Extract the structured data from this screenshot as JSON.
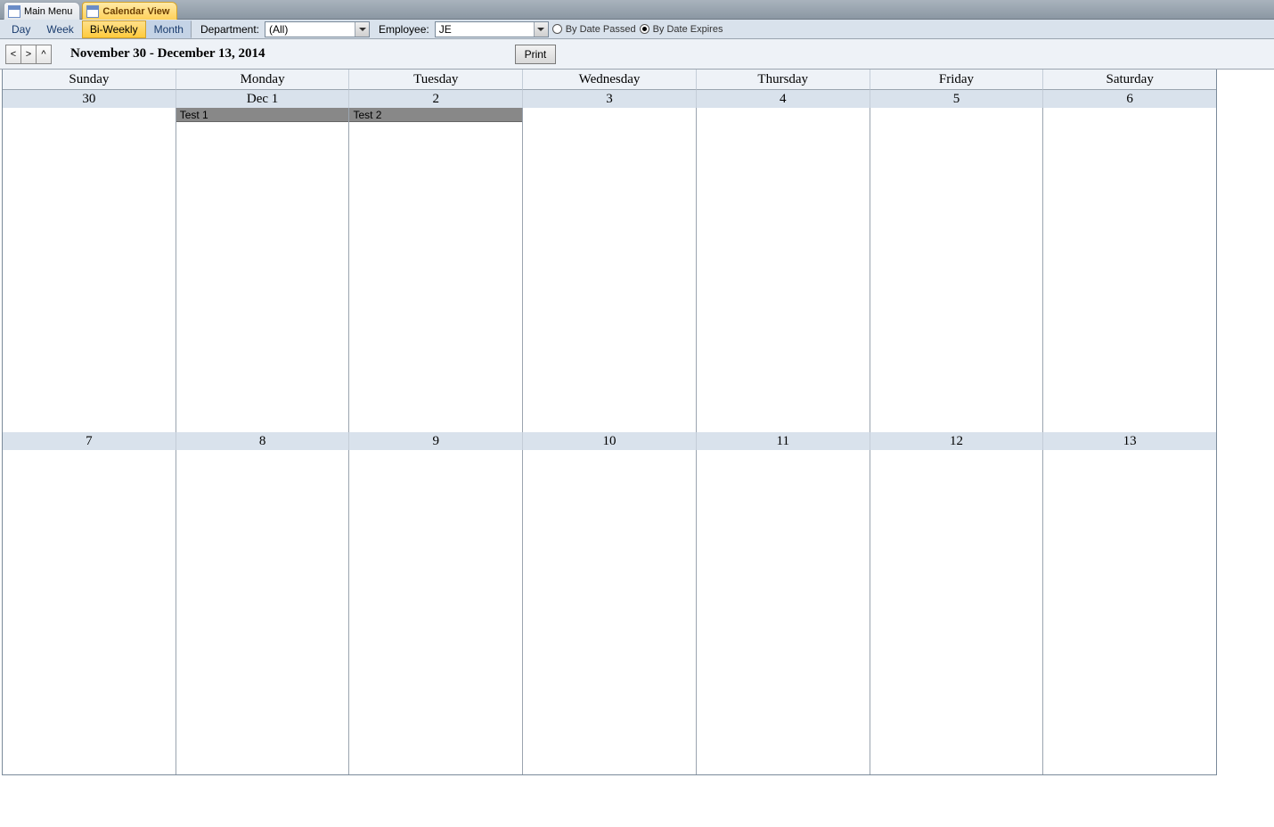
{
  "tabs": {
    "main_menu": "Main Menu",
    "calendar_view": "Calendar View"
  },
  "toolbar": {
    "day": "Day",
    "week": "Week",
    "biweekly": "Bi-Weekly",
    "month": "Month",
    "department_label": "Department:",
    "department_value": "(All)",
    "employee_label": "Employee:",
    "employee_value": "JE",
    "radio_passed": "By Date Passed",
    "radio_expires": "By Date Expires"
  },
  "nav": {
    "prev": "<",
    "next": ">",
    "up": "^",
    "title": "November 30 - December 13, 2014",
    "print": "Print"
  },
  "dayheads": [
    "Sunday",
    "Monday",
    "Tuesday",
    "Wednesday",
    "Thursday",
    "Friday",
    "Saturday"
  ],
  "week1_dates": [
    "30",
    "Dec 1",
    "2",
    "3",
    "4",
    "5",
    "6"
  ],
  "week2_dates": [
    "7",
    "8",
    "9",
    "10",
    "11",
    "12",
    "13"
  ],
  "events": {
    "dec1": "Test 1",
    "dec2": "Test 2"
  }
}
